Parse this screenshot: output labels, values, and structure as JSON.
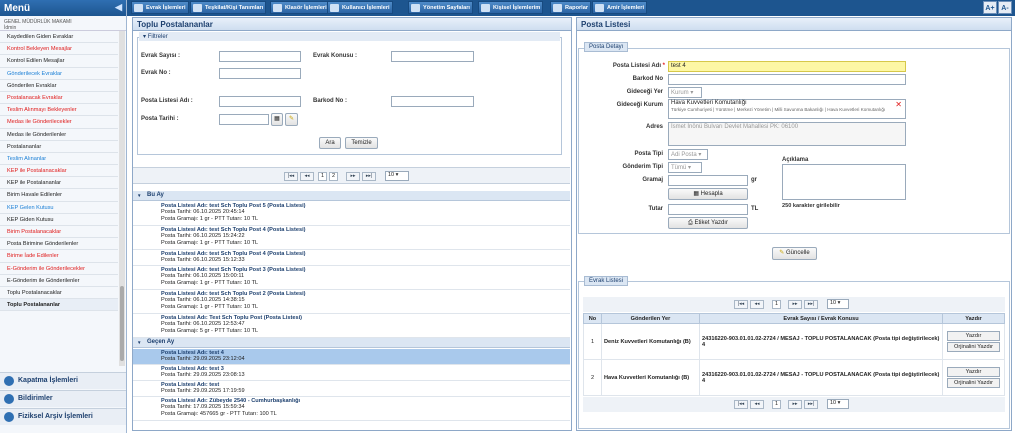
{
  "sidebar": {
    "title": "Menü",
    "org": "GENEL MÜDÜRLÜK MAKAMI",
    "org_sub": "İdmin",
    "items": [
      {
        "label": "Kaydedilen Giden Evraklar",
        "color": "blk"
      },
      {
        "label": "Kontrol Bekleyen Mesajlar",
        "color": "red"
      },
      {
        "label": "Kontrol Edilen Mesajlar",
        "color": "blk"
      },
      {
        "label": "Gönderilecek Evraklar",
        "color": "blu"
      },
      {
        "label": "Gönderilen Evraklar",
        "color": "blk"
      },
      {
        "label": "Postalanacak Evraklar",
        "color": "red"
      },
      {
        "label": "Teslim Alınmayı Bekleyenler",
        "color": "red"
      },
      {
        "label": "Medas ile Gönderilecekler",
        "color": "red"
      },
      {
        "label": "Medas ile Gönderilenler",
        "color": "blk"
      },
      {
        "label": "Postalananlar",
        "color": "blk"
      },
      {
        "label": "Teslim Alınanlar",
        "color": "blu"
      },
      {
        "label": "KEP ile Postalanacaklar",
        "color": "red"
      },
      {
        "label": "KEP ile Postalananlar",
        "color": "blk"
      },
      {
        "label": "Birim Havale Edilenler",
        "color": "blk"
      },
      {
        "label": "KEP Gelen Kutusu",
        "color": "blu"
      },
      {
        "label": "KEP Giden Kutusu",
        "color": "blk"
      },
      {
        "label": "Birim Postalanacaklar",
        "color": "red"
      },
      {
        "label": "Posta Birimine Gönderilenler",
        "color": "blk"
      },
      {
        "label": "Birime İade Edilenler",
        "color": "red"
      },
      {
        "label": "E-Gönderim ile Gönderilecekler",
        "color": "red"
      },
      {
        "label": "E-Gönderim ile Gönderilenler",
        "color": "blk"
      },
      {
        "label": "Toplu Postalanacaklar",
        "color": "blk"
      },
      {
        "label": "Toplu Postalananlar",
        "color": "blk",
        "selected": true
      }
    ],
    "sections": [
      "Kapatma İşlemleri",
      "Bildirimler",
      "Fiziksel Arşiv İşlemleri"
    ]
  },
  "topmenu": [
    "Evrak İşlemleri",
    "Teşkilat/Kişi Tanımları",
    "Klasör İşlemleri",
    "Kullanıcı İşlemleri",
    "Yönetim Sayfaları",
    "Kişisel İşlemlerim",
    "Raporlar",
    "Amir İşlemleri"
  ],
  "font_buttons": [
    "A+",
    "A-"
  ],
  "left_panel": {
    "title": "Toplu Postalananlar",
    "filters_legend": "Filtreler",
    "labels": {
      "evrak_sayisi": "Evrak Sayısı :",
      "evrak_konusu": "Evrak Konusu :",
      "evrak_no": "Evrak No :",
      "posta_listesi_adi": "Posta Listesi Adı :",
      "barkod_no": "Barkod No :",
      "posta_tarihi": "Posta Tarihi :"
    },
    "search_btn": "Ara",
    "clear_btn": "Temizle",
    "pagination": {
      "first": "|◂◂",
      "prev": "◂◂",
      "pages": [
        "1",
        "2"
      ],
      "current": "1",
      "next": "▸▸",
      "last": "▸▸|",
      "page_size": "10"
    },
    "groups": [
      {
        "name": "Bu Ay",
        "items": [
          {
            "title": "Posta Listesi Adı: test Sch Toplu Post 5 (Posta Listesi)",
            "date": "Posta Tarihi: 06.10.2025 20:45:14",
            "weight": "Posta Gramajı: 1 gr - PTT Tutarı: 10 TL"
          },
          {
            "title": "Posta Listesi Adı: test Sch Toplu Post 4 (Posta Listesi)",
            "date": "Posta Tarihi: 06.10.2025 15:24:22",
            "weight": "Posta Gramajı: 1 gr - PTT Tutarı: 10 TL"
          },
          {
            "title": "Posta Listesi Adı: test Sch Toplu Post 4 (Posta Listesi)",
            "date": "Posta Tarihi: 06.10.2025 15:12:33",
            "weight": ""
          },
          {
            "title": "Posta Listesi Adı: test Sch Toplu Post 3 (Posta Listesi)",
            "date": "Posta Tarihi: 06.10.2025 15:00:11",
            "weight": "Posta Gramajı: 1 gr - PTT Tutarı: 10 TL"
          },
          {
            "title": "Posta Listesi Adı: test Sch Toplu Post 2 (Posta Listesi)",
            "date": "Posta Tarihi: 06.10.2025 14:38:15",
            "weight": "Posta Gramajı: 1 gr - PTT Tutarı: 10 TL"
          },
          {
            "title": "Posta Listesi Adı: Test Sch Toplu Post (Posta Listesi)",
            "date": "Posta Tarihi: 06.10.2025 12:53:47",
            "weight": "Posta Gramajı: 5 gr - PTT Tutarı: 10 TL"
          }
        ]
      },
      {
        "name": "Geçen Ay",
        "items": [
          {
            "title": "Posta Listesi Adı: test 4",
            "date": "Posta Tarihi: 29.09.2025 23:12:04",
            "weight": "",
            "selected": true
          },
          {
            "title": "Posta Listesi Adı: test 3",
            "date": "Posta Tarihi: 29.09.2025 23:08:13",
            "weight": ""
          },
          {
            "title": "Posta Listesi Adı: test",
            "date": "Posta Tarihi: 29.09.2025 17:19:59",
            "weight": ""
          },
          {
            "title": "Posta Listesi Adı: Zübeyde 2540 - Cumhurbaşkanlığı",
            "date": "Posta Tarihi: 17.09.2025 15:59:34",
            "weight": "Posta Gramajı: 457665 gr - PTT Tutarı: 100 TL"
          }
        ]
      }
    ]
  },
  "right_panel": {
    "title": "Posta Listesi",
    "detail_legend": "Posta Detayı",
    "labels": {
      "posta_listesi_adi": "Posta Listesi Adı",
      "barkod_no": "Barkod No",
      "gidecegi_yer": "Gideceği Yer",
      "gidecegi_kurum": "Gideceği Kurum",
      "adres": "Adres",
      "posta_tipi": "Posta Tipi",
      "gonderim_tipi": "Gönderim Tipi",
      "gramaj": "Gramaj",
      "tutar": "Tutar",
      "aciklama": "Açıklama"
    },
    "required_mark": "*",
    "values": {
      "posta_listesi_adi": "test 4",
      "gidecegi_yer": "Kurum",
      "kurum_name": "Hava Kuvvetleri Komutanlığı",
      "kurum_path": "Türkiye Cumhuriyeti | Yürütme | Merkezi Yönetim | Milli Savunma Bakanlığı | Hava Kuvvetleri Komutanlığı",
      "adres": "İsmet İnönü Bulvarı   Devlet Mahallesi   PK: 06100",
      "posta_tipi": "Adi Posta",
      "gonderim_tipi": "Tümü",
      "unit_gr": "gr",
      "unit_tl": "TL"
    },
    "char_limit": "250 karakter girilebilir",
    "hesapla_btn": "Hesapla",
    "etiket_btn": "Etiket Yazdır",
    "guncelle_btn": "Güncelle",
    "evrak_legend": "Evrak Listesi",
    "table": {
      "headers": [
        "No",
        "Gönderilen Yer",
        "Evrak Sayısı / Evrak Konusu",
        "Yazdır"
      ],
      "rows": [
        {
          "no": "1",
          "yer": "Deniz Kuvvetleri Komutanlığı (B)",
          "evrak": "24316220-903.01.01.02-2724 / MESAJ - TOPLU POSTALANACAK (Posta tipi değiştirilecek) 4"
        },
        {
          "no": "2",
          "yer": "Hava Kuvvetleri Komutanlığı (B)",
          "evrak": "24316220-903.01.01.02-2724 / MESAJ - TOPLU POSTALANACAK (Posta tipi değiştirilecek) 4"
        }
      ],
      "yazdir_btn": "Yazdır",
      "orjinal_btn": "Orjinalini Yazdır"
    },
    "pagination": {
      "page": "1",
      "page_size": "10"
    }
  }
}
